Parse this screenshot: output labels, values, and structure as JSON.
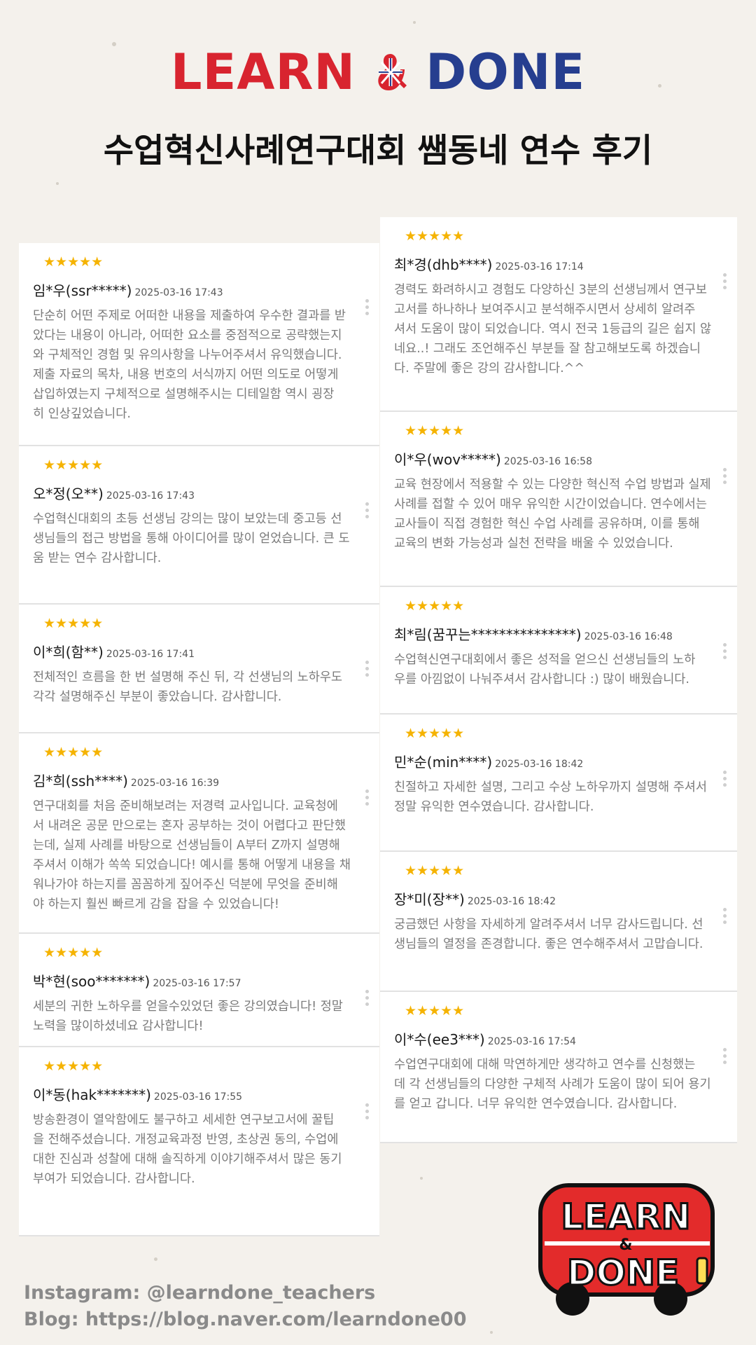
{
  "brand": {
    "logo_word1": "LEARN",
    "logo_word2": "DONE"
  },
  "title": "수업혁신사례연구대회 쌤동네 연수 후기",
  "stars_text": "★★★★★",
  "colors": {
    "brand_red": "#d8242f",
    "brand_blue": "#263e8f",
    "star": "#f5b301"
  },
  "left_reviews": [
    {
      "name": "임*우(ssr*****)",
      "date": "2025-03-16 17:43",
      "lines": [
        "단순히 어떤 주제로 어떠한 내용을 제출하여 우수한 결과를 받",
        "았다는 내용이 아니라, 어떠한 요소를 중점적으로 공략했는지",
        "와 구체적인 경험 및 유의사항을 나누어주셔서 유익했습니다.",
        "제출 자료의 목차, 내용 번호의 서식까지 어떤 의도로 어떻게",
        "삽입하였는지 구체적으로 설명해주시는 디테일함 역시 굉장",
        "히 인상깊었습니다."
      ]
    },
    {
      "name": "오*정(오**)",
      "date": "2025-03-16 17:43",
      "lines": [
        "수업혁신대회의 초등 선생님 강의는 많이 보았는데 중고등 선",
        "생님들의 접근 방법을 통해 아이디어를 많이 얻었습니다. 큰 도",
        "움 받는 연수 감사합니다."
      ]
    },
    {
      "name": "이*희(함**)",
      "date": "2025-03-16 17:41",
      "lines": [
        "전체적인 흐름을 한 번 설명해 주신 뒤, 각 선생님의 노하우도",
        "각각 설명해주신 부분이 좋았습니다. 감사합니다."
      ]
    },
    {
      "name": "김*희(ssh****)",
      "date": "2025-03-16 16:39",
      "lines": [
        "연구대회를 처음 준비해보려는 저경력 교사입니다. 교육청에",
        "서 내려온 공문 만으로는 혼자 공부하는 것이 어렵다고 판단했",
        "는데, 실제 사례를 바탕으로 선생님들이 A부터 Z까지 설명해",
        "주셔서 이해가 쏙쏙 되었습니다! 예시를 통해 어떻게 내용을 채",
        "워나가야 하는지를 꼼꼼하게 짚어주신 덕분에 무엇을 준비해",
        "야 하는지 훨씬 빠르게 감을 잡을 수 있었습니다!"
      ]
    },
    {
      "name": "박*현(soo*******)",
      "date": "2025-03-16 17:57",
      "lines": [
        "세분의 귀한 노하우를 얻을수있었던 좋은 강의였습니다! 정말",
        "노력을 많이하셨네요 감사합니다!"
      ]
    },
    {
      "name": "이*동(hak*******)",
      "date": "2025-03-16 17:55",
      "lines": [
        "방송환경이 열악함에도 불구하고 세세한 연구보고서에 꿀팁",
        "을 전해주셨습니다. 개정교육과정 반영, 초상권 동의, 수업에",
        "대한 진심과 성찰에 대해 솔직하게 이야기해주셔서 많은 동기",
        "부여가 되었습니다. 감사합니다."
      ]
    }
  ],
  "right_reviews": [
    {
      "name": "최*경(dhb****)",
      "date": "2025-03-16 17:14",
      "lines": [
        "경력도 화려하시고 경험도 다양하신 3분의 선생님께서 연구보",
        "고서를 하나하나 보여주시고 분석해주시면서 상세히 알려주",
        "셔서 도움이 많이 되었습니다. 역시 전국 1등급의 길은 쉽지 않",
        "네요..! 그래도 조언해주신 부분들 잘 참고해보도록 하겠습니",
        "다. 주말에 좋은 강의 감사합니다.^^"
      ]
    },
    {
      "name": "이*우(wov*****)",
      "date": "2025-03-16 16:58",
      "lines": [
        "교육 현장에서 적용할 수 있는 다양한 혁신적 수업 방법과 실제",
        "사례를 접할 수 있어 매우 유익한 시간이었습니다. 연수에서는",
        "교사들이 직접 경험한 혁신 수업 사례를 공유하며, 이를 통해",
        "교육의 변화 가능성과 실천 전략을 배울 수 있었습니다."
      ]
    },
    {
      "name": "최*림(꿈꾸는***************)",
      "date": "2025-03-16 16:48",
      "lines": [
        "수업혁신연구대회에서 좋은 성적을 얻으신 선생님들의 노하",
        "우를 아낌없이 나눠주셔서 감사합니다 :) 많이 배웠습니다."
      ]
    },
    {
      "name": "민*순(min****)",
      "date": "2025-03-16 18:42",
      "lines": [
        "친절하고 자세한 설명, 그리고 수상 노하우까지 설명해 주셔서",
        "정말 유익한 연수였습니다. 감사합니다."
      ]
    },
    {
      "name": "장*미(장**)",
      "date": "2025-03-16 18:42",
      "lines": [
        "궁금했던 사항을 자세하게 알려주셔서 너무 감사드립니다. 선",
        "생님들의 열정을 존경합니다. 좋은 연수해주셔서 고맙습니다."
      ]
    },
    {
      "name": "이*수(ee3***)",
      "date": "2025-03-16 17:54",
      "lines": [
        "수업연구대회에 대해 막연하게만 생각하고 연수를 신청했는",
        "데 각 선생님들의 다양한 구체적 사례가 도움이 많이 되어 용기",
        "를 얻고 갑니다. 너무 유익한 연수였습니다. 감사합니다."
      ]
    }
  ],
  "footer": {
    "instagram": "Instagram: @learndone_teachers",
    "blog": "Blog: https://blog.naver.com/learndone00"
  },
  "bus_logo": {
    "line1": "LEARN",
    "amp": "&",
    "line2": "DONE"
  }
}
